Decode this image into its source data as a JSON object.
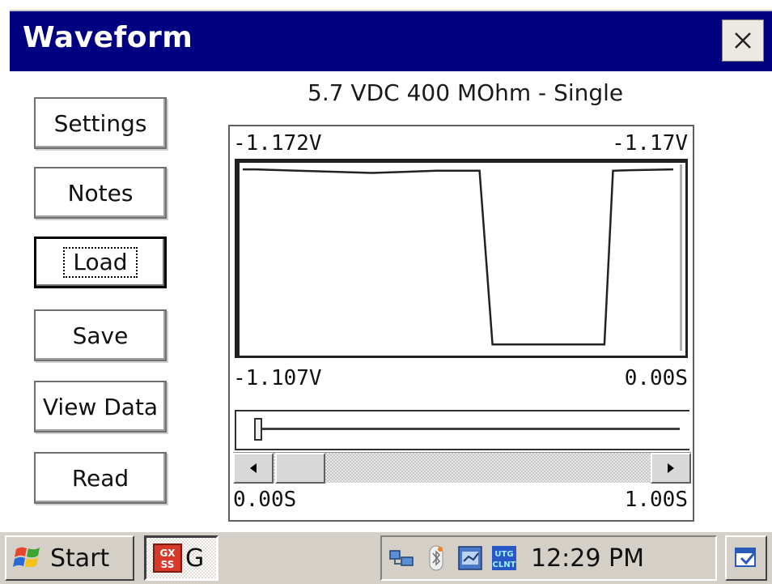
{
  "window": {
    "title": "Waveform",
    "subtitle": "5.7 VDC 400 MOhm - Single",
    "titlebar_color": "#000080"
  },
  "buttons": {
    "settings": "Settings",
    "notes": "Notes",
    "load": "Load",
    "save": "Save",
    "view_data": "View Data",
    "read": "Read"
  },
  "plot": {
    "top_left_label": "-1.172V",
    "top_right_label": "-1.17V",
    "bottom_left_label": "-1.107V",
    "bottom_right_label": "0.00S"
  },
  "scroll": {
    "start_label": "0.00S",
    "end_label": "1.00S"
  },
  "chart_data": {
    "type": "line",
    "x": [
      0.0,
      0.03,
      0.15,
      0.3,
      0.45,
      0.55,
      0.58,
      0.74,
      0.84,
      0.86,
      0.9,
      1.0
    ],
    "series": [
      {
        "values": [
          -1.1708,
          -1.1708,
          -1.1702,
          -1.1695,
          -1.1703,
          -1.1703,
          -1.1075,
          -1.1075,
          -1.1075,
          -1.1703,
          -1.1705,
          -1.1708
        ]
      }
    ],
    "ylim": [
      -1.172,
      -1.107
    ],
    "xlim": [
      0.0,
      1.0
    ],
    "grid": false,
    "line_color": "#222222"
  },
  "taskbar": {
    "start_label": "Start",
    "task_label": "G",
    "task_icon_text": "GX SS",
    "tray_icon_text": "UTG CLNT",
    "clock": "12:29 PM"
  }
}
